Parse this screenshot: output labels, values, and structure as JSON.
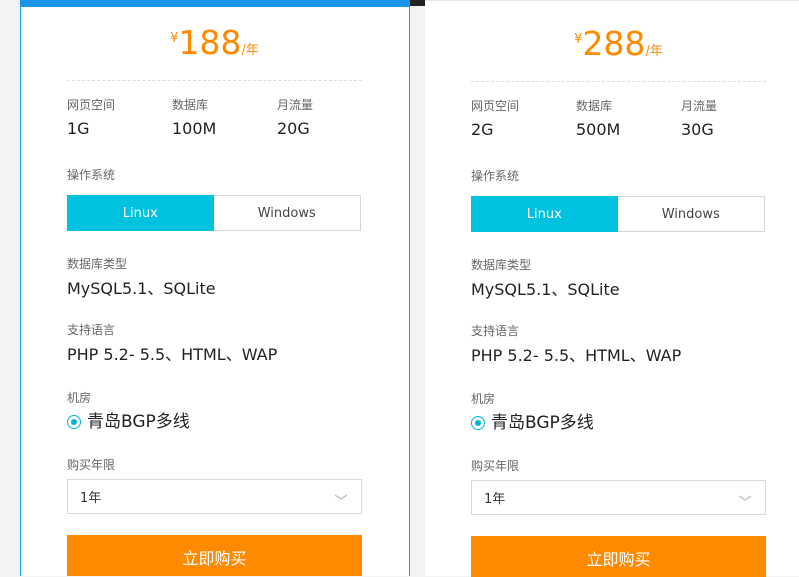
{
  "colors": {
    "accent": "#00c1de",
    "price": "#ff8a00",
    "buy_button": "#ff8a00",
    "top_bar": "#1a96e8",
    "card_border": "#00b4d8"
  },
  "cards": [
    {
      "price": {
        "currency": "¥",
        "amount": "188",
        "unit": "/年"
      },
      "specs": [
        {
          "label": "网页空间",
          "value": "1G"
        },
        {
          "label": "数据库",
          "value": "100M"
        },
        {
          "label": "月流量",
          "value": "20G"
        }
      ],
      "os_label": "操作系统",
      "os_options": [
        "Linux",
        "Windows"
      ],
      "os_selected": "Linux",
      "db_label": "数据库类型",
      "db_value": "MySQL5.1、SQLite",
      "lang_label": "支持语言",
      "lang_value": "PHP 5.2- 5.5、HTML、WAP",
      "room_label": "机房",
      "room_value": "青岛BGP多线",
      "period_label": "购买年限",
      "period_value": "1年",
      "buy_label": "立即购买"
    },
    {
      "price": {
        "currency": "¥",
        "amount": "288",
        "unit": "/年"
      },
      "specs": [
        {
          "label": "网页空间",
          "value": "2G"
        },
        {
          "label": "数据库",
          "value": "500M"
        },
        {
          "label": "月流量",
          "value": "30G"
        }
      ],
      "os_label": "操作系统",
      "os_options": [
        "Linux",
        "Windows"
      ],
      "os_selected": "Linux",
      "db_label": "数据库类型",
      "db_value": "MySQL5.1、SQLite",
      "lang_label": "支持语言",
      "lang_value": "PHP 5.2- 5.5、HTML、WAP",
      "room_label": "机房",
      "room_value": "青岛BGP多线",
      "period_label": "购买年限",
      "period_value": "1年",
      "buy_label": "立即购买"
    }
  ]
}
